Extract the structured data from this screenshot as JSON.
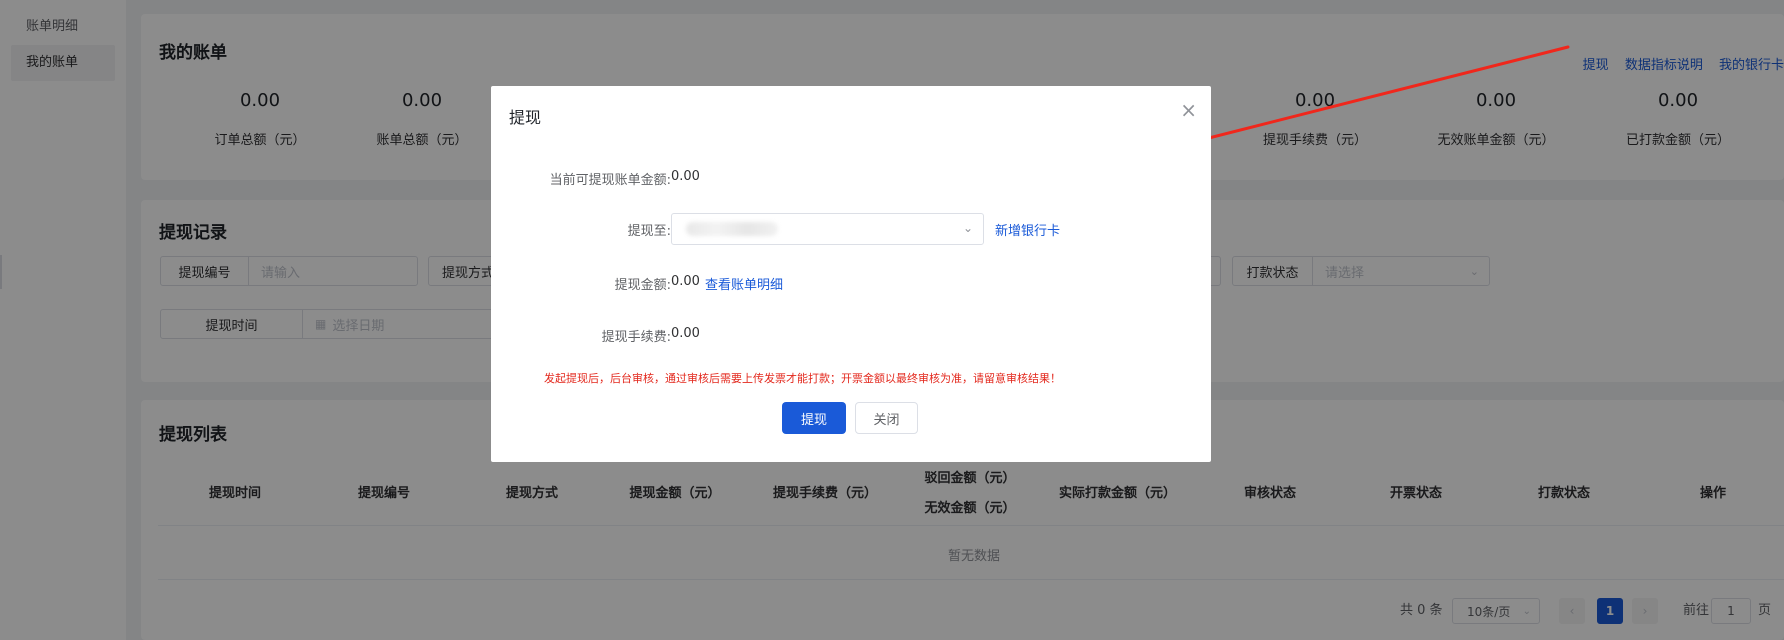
{
  "sidebar": {
    "items": [
      {
        "label": "账单明细",
        "active": false
      },
      {
        "label": "我的账单",
        "active": true
      }
    ]
  },
  "my_bill": {
    "title": "我的账单",
    "links": [
      "提现",
      "数据指标说明",
      "我的银行卡"
    ],
    "stats": [
      {
        "value": "0.00",
        "label": "订单总额（元）"
      },
      {
        "value": "0.00",
        "label": "账单总额（元）"
      },
      {
        "value": "0.00",
        "label": "提现手续费（元）"
      },
      {
        "value": "0.00",
        "label": "无效账单金额（元）"
      },
      {
        "value": "0.00",
        "label": "已打款金额（元）"
      }
    ]
  },
  "records": {
    "title": "提现记录",
    "filters": {
      "withdraw_no": {
        "label": "提现编号",
        "placeholder": "请输入"
      },
      "method": {
        "label": "提现方式"
      },
      "pay_status": {
        "label": "打款状态",
        "placeholder": "请选择"
      },
      "time": {
        "label": "提现时间",
        "placeholder": "选择日期"
      }
    }
  },
  "list": {
    "title": "提现列表",
    "columns": [
      "提现时间",
      "提现编号",
      "提现方式",
      "提现金额（元）",
      "提现手续费（元）",
      "驳回金额（元）",
      "无效金额（元）",
      "实际打款金额（元）",
      "审核状态",
      "开票状态",
      "打款状态",
      "操作"
    ],
    "empty_text": "暂无数据",
    "pagination": {
      "total": "共 0 条",
      "page_size": "10条/页",
      "prev": "‹",
      "current_page": "1",
      "next": "›",
      "goto_label": "前往",
      "goto_value": "1",
      "page_suffix": "页"
    }
  },
  "modal": {
    "title": "提现",
    "close_glyph": "×",
    "available_label": "当前可提现账单金额:",
    "available_value": "0.00",
    "to_label": "提现至:",
    "add_card_link": "新增银行卡",
    "amount_label": "提现金额:",
    "amount_value": "0.00",
    "view_detail_link": "查看账单明细",
    "fee_label": "提现手续费:",
    "fee_value": "0.00",
    "warning": "发起提现后，后台审核，通过审核后需要上传发票才能打款；开票金额以最终审核为准，请留意审核结果！",
    "submit_label": "提现",
    "close_label": "关闭"
  },
  "colors": {
    "primary": "#1a5ad8",
    "warning": "#e3281d",
    "annotation_arrow": "#f0271c"
  }
}
